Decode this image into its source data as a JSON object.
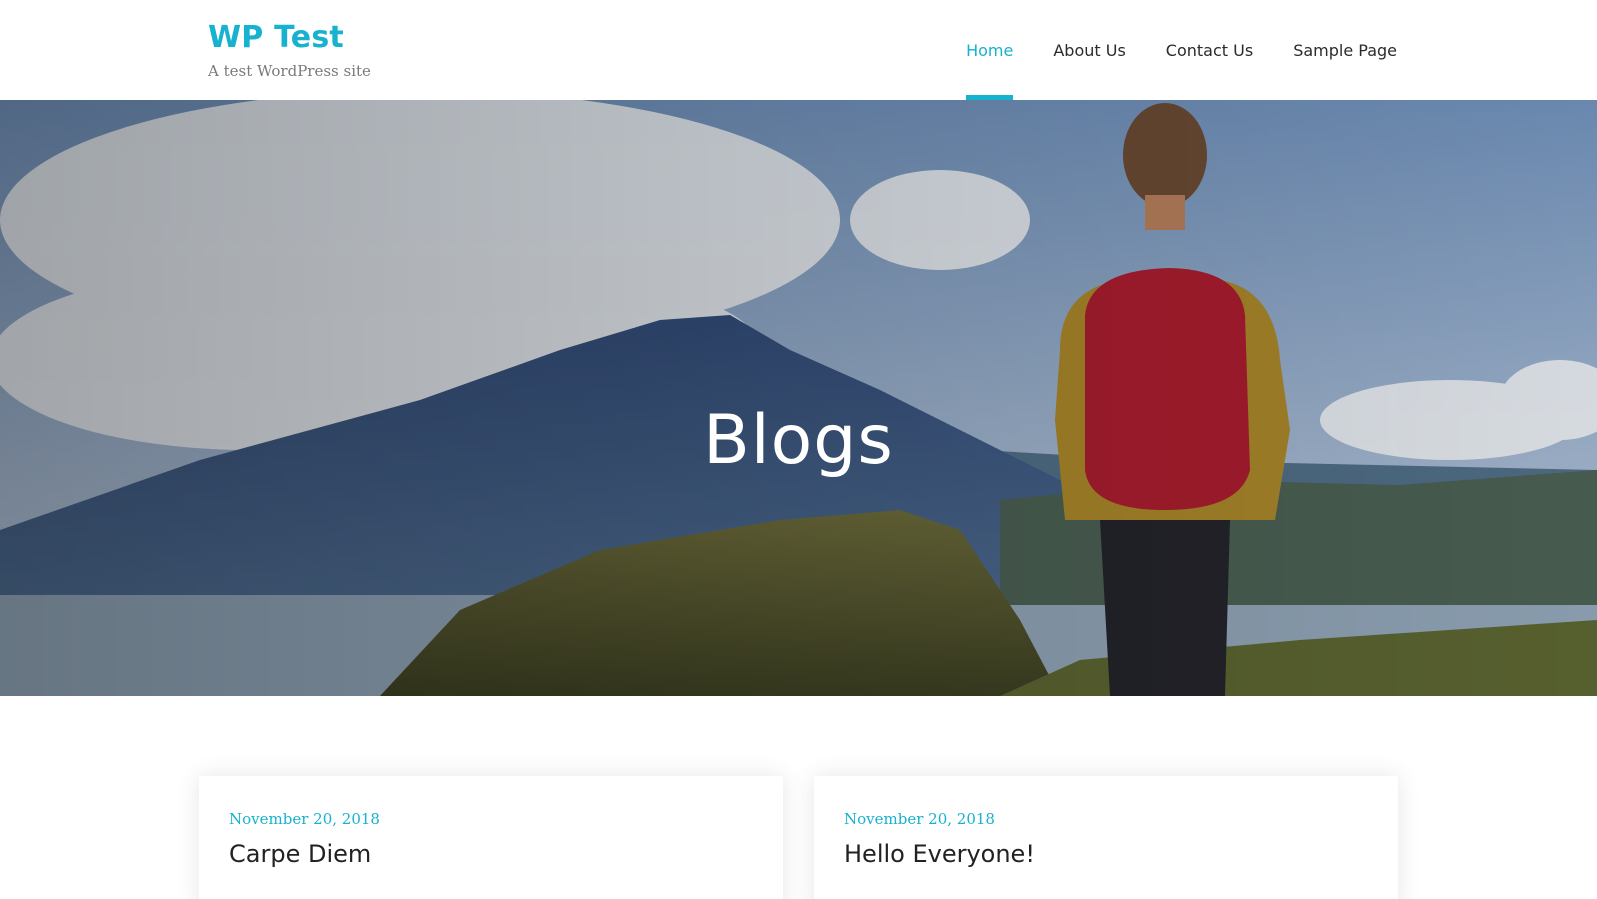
{
  "site": {
    "title": "WP Test",
    "tagline": "A test WordPress site"
  },
  "nav": {
    "items": [
      {
        "label": "Home",
        "active": true
      },
      {
        "label": "About Us",
        "active": false
      },
      {
        "label": "Contact Us",
        "active": false
      },
      {
        "label": "Sample Page",
        "active": false
      }
    ]
  },
  "hero": {
    "title": "Blogs"
  },
  "posts": [
    {
      "date": "November 20, 2018",
      "title": "Carpe Diem"
    },
    {
      "date": "November 20, 2018",
      "title": "Hello Everyone!"
    }
  ],
  "colors": {
    "accent": "#16b2cf",
    "text": "#2b2b2b",
    "tagline": "#7a7a7a"
  }
}
